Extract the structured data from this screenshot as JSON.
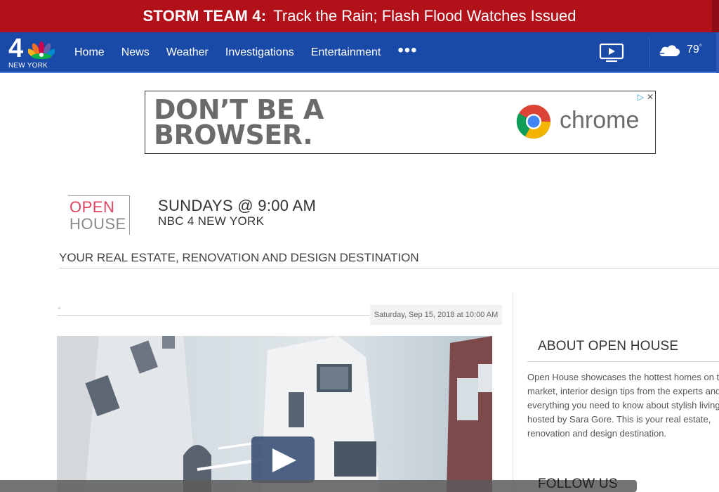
{
  "alert": {
    "label": "STORM TEAM 4:",
    "text": "Track the Rain; Flash Flood Watches Issued",
    "color": "#b3111a"
  },
  "nav": {
    "logo_text": "NEW YORK",
    "logo_number": "4",
    "items": [
      {
        "label": "Home"
      },
      {
        "label": "News"
      },
      {
        "label": "Weather"
      },
      {
        "label": "Investigations"
      },
      {
        "label": "Entertainment"
      }
    ],
    "more_label": "•••",
    "weather_temp": "79",
    "weather_degree": "°",
    "color": "#1a4aa8"
  },
  "ad": {
    "headline_line1": "DON’T BE A",
    "headline_line2": "BROWSER.",
    "brand": "chrome",
    "choices_icon": "▷",
    "close_icon": "✕"
  },
  "show": {
    "logo_line1": "OPEN",
    "logo_line2": "HOUSE",
    "time": "SUNDAYS @ 9:00 AM",
    "station": "NBC 4 NEW YORK",
    "tagline": "YOUR REAL ESTATE, RENOVATION AND DESIGN DESTINATION"
  },
  "article": {
    "date": "Saturday, Sep 15, 2018 at 10:00 AM",
    "tiny_mark": "≡"
  },
  "sidebar": {
    "about_title": "ABOUT OPEN HOUSE",
    "about_text": "Open House showcases the hottest homes on the market, interior design tips from the experts and everything you need to know about stylish living, hosted by Sara Gore. This is your real estate, renovation and design destination.",
    "follow_title": "FOLLOW US"
  }
}
